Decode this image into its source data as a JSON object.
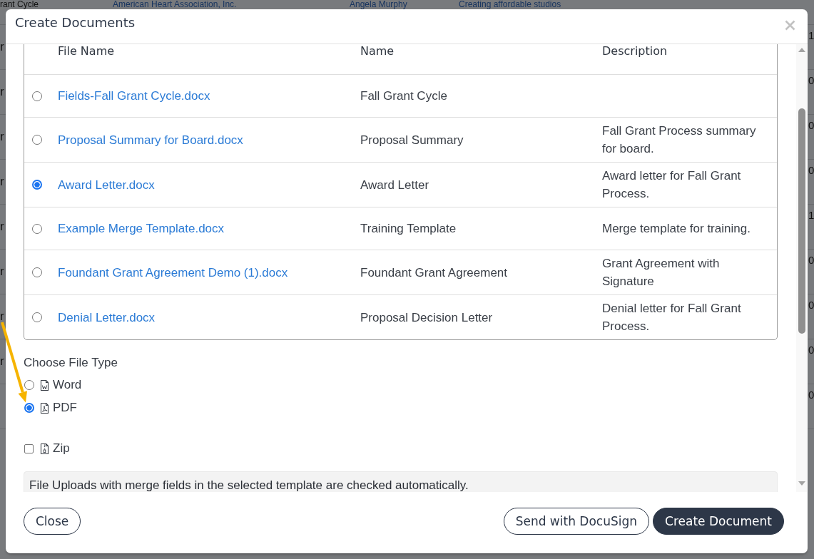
{
  "background_table": {
    "rows": [
      {
        "column_1": "rant Cycle",
        "column_2": "American Heart Association, Inc.",
        "column_3": "Angela Murphy",
        "column_4": "Creating affordable studios"
      },
      {
        "column_1": "r",
        "column_5": "1"
      },
      {
        "column_1": "r",
        "column_5": "0"
      },
      {
        "column_1": "r",
        "column_5": "0"
      },
      {
        "column_1": "r",
        "column_5": "0"
      },
      {
        "column_1": "r",
        "column_5": "1"
      },
      {
        "column_1": "r",
        "column_5": "0"
      },
      {
        "column_1": "r",
        "column_5": "0"
      },
      {
        "column_1": "r",
        "column_5": "0"
      },
      {
        "column_5": "0"
      }
    ]
  },
  "dialog": {
    "title": "Create Documents",
    "table": {
      "columns": [
        "File Name",
        "Name",
        "Description"
      ],
      "rows": [
        {
          "selected": false,
          "file_name": "Fields-Fall Grant Cycle.docx",
          "name": "Fall Grant Cycle"
        },
        {
          "selected": false,
          "file_name": "Proposal Summary for Board.docx",
          "name": "Proposal Summary",
          "description": "Fall Grant Process summary for board."
        },
        {
          "selected": true,
          "file_name": "Award Letter.docx",
          "name": "Award Letter",
          "description": "Award letter for Fall Grant Process."
        },
        {
          "selected": false,
          "file_name": "Example Merge Template.docx",
          "name": "Training Template",
          "description": "Merge template for training."
        },
        {
          "selected": false,
          "file_name": "Foundant Grant Agreement Demo (1).docx",
          "name": "Foundant Grant Agreement",
          "description": "Grant Agreement with Signature"
        },
        {
          "selected": false,
          "file_name": "Denial Letter.docx",
          "name": "Proposal Decision Letter",
          "description": "Denial letter for Fall Grant Process."
        }
      ]
    },
    "file_type": {
      "label": "Choose File Type",
      "options": [
        {
          "kind": "radio",
          "label": "Word",
          "selected": false
        },
        {
          "kind": "radio",
          "label": "PDF",
          "selected": true
        },
        {
          "kind": "checkbox",
          "label": "Zip",
          "checked": false
        }
      ]
    },
    "note": "File Uploads with merge fields in the selected template are checked automatically.",
    "footer": {
      "left": [
        {
          "kind": "outline",
          "label": "Close"
        }
      ],
      "right": [
        {
          "kind": "outline",
          "label": "Send with DocuSign"
        },
        {
          "kind": "primary",
          "label": "Create Document"
        }
      ]
    }
  }
}
